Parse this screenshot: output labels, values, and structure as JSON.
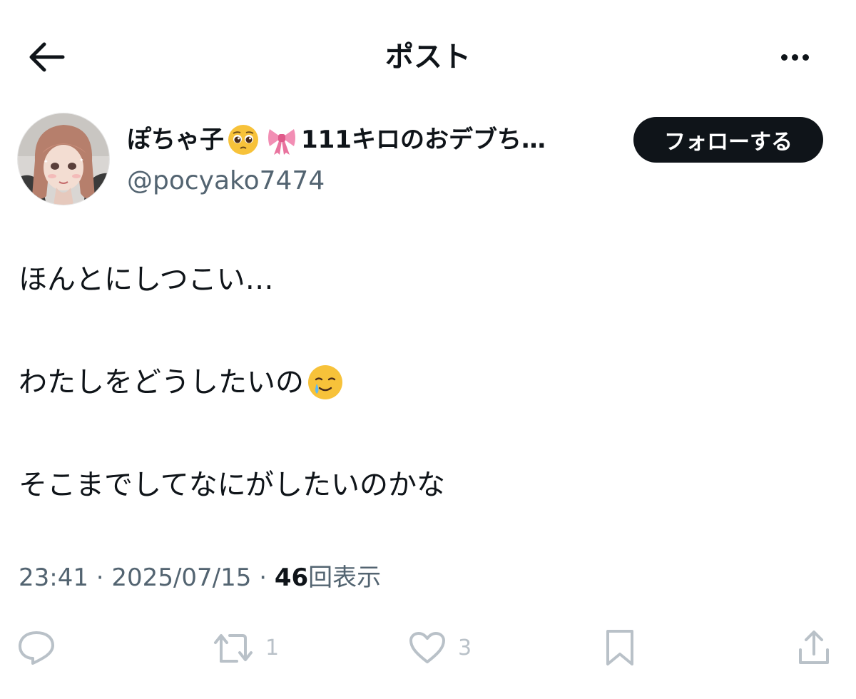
{
  "header": {
    "title": "ポスト"
  },
  "author": {
    "display_name": "ぽちゃ子",
    "display_name_suffix": "111キロのおデブち…",
    "handle": "@pocyako7474",
    "follow_label": "フォローする"
  },
  "post": {
    "lines": [
      "ほんとにしつこい…",
      "わたしをどうしたいの",
      "そこまでしてなにがしたいのかな"
    ],
    "time": "23:41",
    "separator": "·",
    "date": "2025/07/15",
    "views": "46",
    "views_label": "回表示"
  },
  "actions": {
    "retweet_count": "1",
    "like_count": "3"
  },
  "icons": {
    "back": "arrow-left-icon",
    "more": "more-horizontal-icon",
    "reply": "reply-icon",
    "retweet": "retweet-icon",
    "like": "heart-icon",
    "bookmark": "bookmark-icon",
    "share": "share-icon",
    "pleading": "pleading-face-emoji",
    "ribbon": "ribbon-emoji",
    "tearful_smile": "smiling-face-with-tear-emoji"
  },
  "colors": {
    "text": "#0f1419",
    "secondary_text": "#536471",
    "muted_icon": "#b9c1c8",
    "follow_button_bg": "#0f1419"
  }
}
